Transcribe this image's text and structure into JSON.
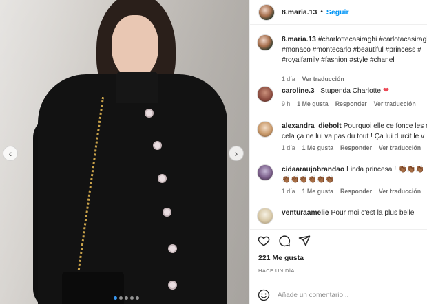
{
  "post": {
    "username": "8.maria.13",
    "separator": "•",
    "follow_label": "Seguir"
  },
  "caption": {
    "username": "8.maria.13",
    "text_line1": "#charlottecasiraghi #carlotacasiraghi",
    "text_line2": "#monaco #montecarlo #beautiful #princess #",
    "text_line3": "#royalfamily #fashion #style #chanel",
    "time": "1 día",
    "translate": "Ver traducción"
  },
  "comments": [
    {
      "username": "caroline.3_",
      "text": "Stupenda Charlotte",
      "time": "9 h",
      "likes": "1 Me gusta",
      "reply": "Responder",
      "translate": "Ver traducción"
    },
    {
      "username": "alexandra_diebolt",
      "text_line1": "Pourquoi elle ce fonce les c",
      "text_line2": "cela ça ne lui va pas du tout ! Ça lui durcit le v",
      "time": "1 día",
      "likes": "1 Me gusta",
      "reply": "Responder",
      "translate": "Ver traducción"
    },
    {
      "username": "cidaaraujobrandao",
      "text": "Linda princesa !",
      "emoji_line1": "👏🏾👏🏾👏🏾",
      "emoji_line2": "👏🏾👏🏾👏🏾👏🏾👏🏾👏🏾",
      "time": "1 día",
      "likes": "1 Me gusta",
      "reply": "Responder",
      "translate": "Ver traducción"
    },
    {
      "username": "venturaamelie",
      "text": "Pour moi c'est la plus belle"
    }
  ],
  "stats": {
    "likes": "221 Me gusta",
    "posted": "HACE UN DÍA"
  },
  "add_comment": {
    "placeholder": "Añade un comentario..."
  },
  "icons": {
    "like": "heart-icon",
    "comment": "comment-icon",
    "share": "share-icon",
    "emoji": "emoji-icon",
    "liked_heart": "red-heart-icon",
    "prev": "chevron-left-icon",
    "next": "chevron-right-icon"
  },
  "colors": {
    "accent": "#0095f6",
    "heart": "#ed4956",
    "muted": "#737373",
    "carousel_active": "#3897f0"
  },
  "carousel": {
    "count": 5,
    "active_index": 0
  }
}
